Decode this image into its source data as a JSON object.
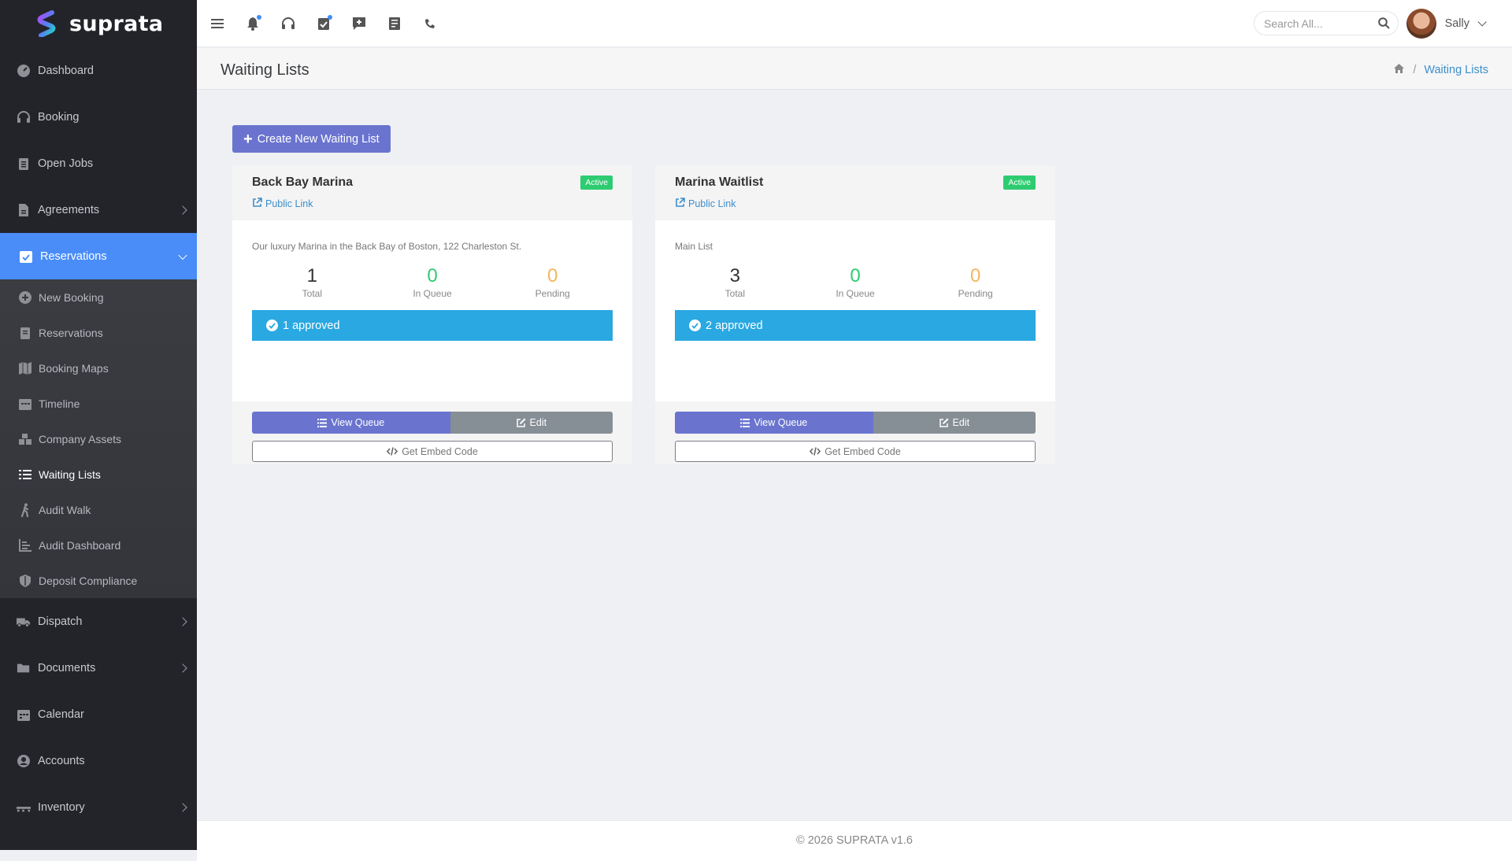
{
  "brand": {
    "name": "suprata"
  },
  "sidebar": {
    "items_top": [
      {
        "label": "Dashboard",
        "icon": "dashboard-icon"
      },
      {
        "label": "Booking",
        "icon": "headset-icon"
      },
      {
        "label": "Open Jobs",
        "icon": "clipboard-icon"
      },
      {
        "label": "Agreements",
        "icon": "document-icon"
      }
    ],
    "active": {
      "label": "Reservations",
      "icon": "calendar-check-icon"
    },
    "submenu": [
      {
        "label": "New Booking"
      },
      {
        "label": "Reservations"
      },
      {
        "label": "Booking Maps"
      },
      {
        "label": "Timeline"
      },
      {
        "label": "Company Assets"
      },
      {
        "label": "Waiting Lists"
      },
      {
        "label": "Audit Walk"
      },
      {
        "label": "Audit Dashboard"
      },
      {
        "label": "Deposit Compliance"
      }
    ],
    "items_bottom": [
      {
        "label": "Dispatch"
      },
      {
        "label": "Documents"
      },
      {
        "label": "Calendar"
      },
      {
        "label": "Accounts"
      },
      {
        "label": "Inventory"
      }
    ]
  },
  "topbar": {
    "search_placeholder": "Search All...",
    "user_name": "Sally"
  },
  "page": {
    "title": "Waiting Lists",
    "breadcrumb_current": "Waiting Lists",
    "create_button": "Create New Waiting List"
  },
  "cards": [
    {
      "title": "Back Bay Marina",
      "status": "Active",
      "public_link": "Public Link",
      "description": "Our luxury Marina in the Back Bay of Boston, 122 Charleston St.",
      "total": "1",
      "in_queue": "0",
      "pending": "0",
      "total_label": "Total",
      "queue_label": "In Queue",
      "pending_label": "Pending",
      "approved": "1 approved",
      "view_queue": "View Queue",
      "edit": "Edit",
      "embed": "Get Embed Code"
    },
    {
      "title": "Marina Waitlist",
      "status": "Active",
      "public_link": "Public Link",
      "description": "Main List",
      "total": "3",
      "in_queue": "0",
      "pending": "0",
      "total_label": "Total",
      "queue_label": "In Queue",
      "pending_label": "Pending",
      "approved": "2 approved",
      "view_queue": "View Queue",
      "edit": "Edit",
      "embed": "Get Embed Code"
    }
  ],
  "footer": {
    "text": "© 2026 SUPRATA v1.6"
  },
  "colors": {
    "sidebar_bg": "#22242a",
    "active_nav": "#4a8df8",
    "primary_button": "#6a74cf",
    "approved_bar": "#29a8e2",
    "active_badge": "#2ecc71",
    "pending_number": "#f4b55c"
  }
}
